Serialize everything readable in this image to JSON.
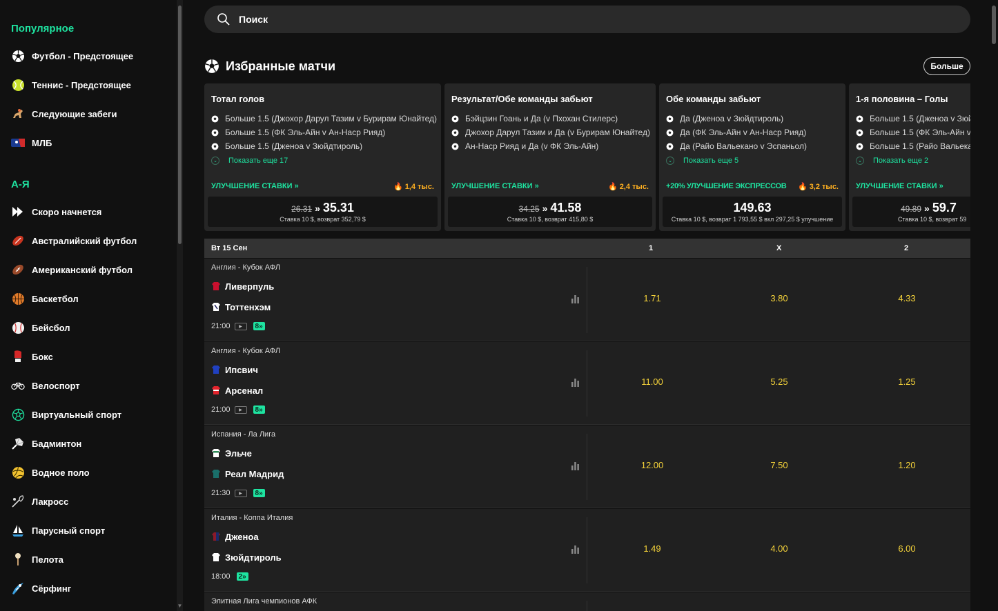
{
  "search": {
    "placeholder": "Поиск"
  },
  "sidebar": {
    "popular_title": "Популярное",
    "popular": [
      {
        "icon": "soccer-ball-icon",
        "label": "Футбол - Предстоящее"
      },
      {
        "icon": "tennis-ball-icon",
        "label": "Теннис - Предстоящее"
      },
      {
        "icon": "horse-racing-icon",
        "label": "Следующие забеги"
      },
      {
        "icon": "mlb-logo-icon",
        "label": "МЛБ"
      }
    ],
    "az_title": "А-Я",
    "az": [
      {
        "icon": "starting-soon-icon",
        "label": "Скоро начнется"
      },
      {
        "icon": "australian-football-icon",
        "label": "Австралийский футбол"
      },
      {
        "icon": "american-football-icon",
        "label": "Американский футбол"
      },
      {
        "icon": "basketball-icon",
        "label": "Баскетбол"
      },
      {
        "icon": "baseball-icon",
        "label": "Бейсбол"
      },
      {
        "icon": "boxing-glove-icon",
        "label": "Бокс"
      },
      {
        "icon": "bicycle-icon",
        "label": "Велоспорт"
      },
      {
        "icon": "virtual-sports-icon",
        "label": "Виртуальный спорт"
      },
      {
        "icon": "badminton-icon",
        "label": "Бадминтон"
      },
      {
        "icon": "water-polo-icon",
        "label": "Водное поло"
      },
      {
        "icon": "lacrosse-icon",
        "label": "Лакросс"
      },
      {
        "icon": "sailing-icon",
        "label": "Парусный спорт"
      },
      {
        "icon": "pelota-icon",
        "label": "Пелота"
      },
      {
        "icon": "surfing-icon",
        "label": "Сёрфинг"
      }
    ]
  },
  "featured": {
    "title": "Избранные матчи",
    "more_label": "Больше",
    "cards": [
      {
        "title": "Тотал голов",
        "legs": [
          "Больше 1.5 (Джохор Дарул Тазим v Бурирам Юнайтед)",
          "Больше 1.5 (ФК Эль-Айн v Ан-Наср Рияд)",
          "Больше 1.5 (Дженоа v Зюйдтироль)"
        ],
        "show_more": "Показать еще 17",
        "boost_label": "УЛУЧШЕНИЕ СТАВКИ »",
        "hot": "1,4 тыс.",
        "old_odds": "26.31",
        "new_odds": "35.31",
        "stake_text": "Ставка 10 $, возврат 352,79 $"
      },
      {
        "title": "Результат/Обе команды забьют",
        "legs": [
          "Бэйцзин Гоань и Да (v Пхохан Стилерс)",
          "Джохор Дарул Тазим и Да (v Бурирам Юнайтед)",
          "Ан-Наср Рияд и Да (v ФК Эль-Айн)"
        ],
        "show_more": "",
        "boost_label": "УЛУЧШЕНИЕ СТАВКИ »",
        "hot": "2,4 тыс.",
        "old_odds": "34.25",
        "new_odds": "41.58",
        "stake_text": "Ставка 10 $, возврат 415,80 $"
      },
      {
        "title": "Обе команды забьют",
        "legs": [
          "Да (Дженоа v Зюйдтироль)",
          "Да (ФК Эль-Айн v Ан-Наср Рияд)",
          "Да (Райо Вальекано v Эспаньол)"
        ],
        "show_more": "Показать еще 5",
        "boost_label": "+20% УЛУЧШЕНИЕ ЭКСПРЕССОВ",
        "hot": "3,2 тыс.",
        "old_odds": "",
        "new_odds": "149.63",
        "stake_text": "Ставка 10 $, возврат 1 793,55 $ вкл 297,25 $ улучшение"
      },
      {
        "title": "1-я половина – Голы",
        "legs": [
          "Больше 1.5 (Дженоа v Зюй",
          "Больше 1.5 (ФК Эль-Айн v",
          "Больше 1.5 (Райо Вальекан"
        ],
        "show_more": "Показать еще 2",
        "boost_label": "УЛУЧШЕНИЕ СТАВКИ »",
        "hot": "",
        "old_odds": "49.89",
        "new_odds": "59.7",
        "stake_text": "Ставка 10 $, возврат 59"
      }
    ]
  },
  "table": {
    "date": "Вт 15 Сен",
    "col1": "1",
    "colx": "X",
    "col2": "2",
    "matches": [
      {
        "league": "Англия - Кубок АФЛ",
        "home": "Ливерпуль",
        "away": "Тоттенхэм",
        "time": "21:00",
        "badge": "8»",
        "o1": "1.71",
        "ox": "3.80",
        "o2": "4.33",
        "home_color": "#c8102e",
        "away_color": "#ffffff"
      },
      {
        "league": "Англия - Кубок АФЛ",
        "home": "Ипсвич",
        "away": "Арсенал",
        "time": "21:00",
        "badge": "8»",
        "o1": "11.00",
        "ox": "5.25",
        "o2": "1.25",
        "home_color": "#2040c0",
        "away_color": "#e3232c"
      },
      {
        "league": "Испания - Ла Лига",
        "home": "Эльче",
        "away": "Реал Мадрид",
        "time": "21:30",
        "badge": "8»",
        "o1": "12.00",
        "ox": "7.50",
        "o2": "1.20",
        "home_color": "#2e8b57",
        "away_color": "#1a6f6a"
      },
      {
        "league": "Италия - Коппа Италия",
        "home": "Дженоа",
        "away": "Зюйдтироль",
        "time": "18:00",
        "badge": "2»",
        "o1": "1.49",
        "ox": "4.00",
        "o2": "6.00",
        "home_color": "#8b1a2b",
        "away_color": "#ffffff"
      },
      {
        "league": "Элитная Лига чемпионов АФК",
        "home": "",
        "away": "",
        "time": "",
        "badge": "",
        "o1": "",
        "ox": "",
        "o2": "",
        "home_color": "#ffffff",
        "away_color": "#ffffff"
      }
    ]
  },
  "colors": {
    "accent": "#1ee3a0",
    "odds": "#f5d33a",
    "hot": "#ffb020",
    "bg": "#111111",
    "card": "#262626"
  }
}
